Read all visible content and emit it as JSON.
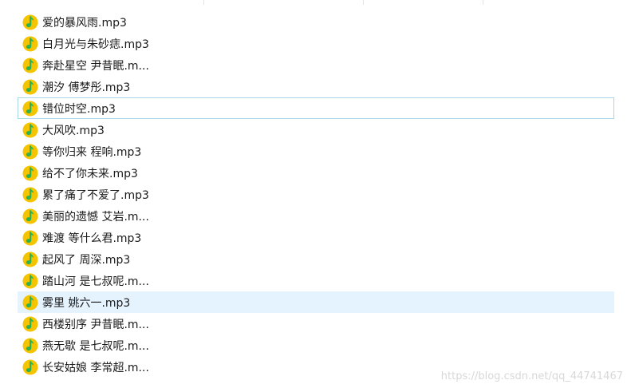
{
  "colors": {
    "icon_yellow": "#f5c400",
    "icon_green": "#2fb14f",
    "selected_bg": "#e5f3ff",
    "focus_border": "#a8d8e8"
  },
  "file_icon": "qq-music-file-icon",
  "files": [
    {
      "name": "爱的暴风雨.mp3"
    },
    {
      "name": "白月光与朱砂痣.mp3"
    },
    {
      "name": "奔赴星空 尹昔眠.m..."
    },
    {
      "name": "潮汐 傅梦彤.mp3"
    },
    {
      "name": "错位时空.mp3",
      "state": "focused"
    },
    {
      "name": "大风吹.mp3"
    },
    {
      "name": "等你归来 程响.mp3"
    },
    {
      "name": "给不了你未来.mp3"
    },
    {
      "name": "累了痛了不爱了.mp3"
    },
    {
      "name": "美丽的遗憾 艾岩.m..."
    },
    {
      "name": "难渡 等什么君.mp3"
    },
    {
      "name": "起风了 周深.mp3"
    },
    {
      "name": "踏山河 是七叔呢.m..."
    },
    {
      "name": "雾里 姚六一.mp3",
      "state": "selected"
    },
    {
      "name": "西楼别序 尹昔眠.m..."
    },
    {
      "name": "燕无歇 是七叔呢.m..."
    },
    {
      "name": "长安姑娘 李常超.m..."
    }
  ],
  "watermark": "https://blog.csdn.net/qq_44741467"
}
